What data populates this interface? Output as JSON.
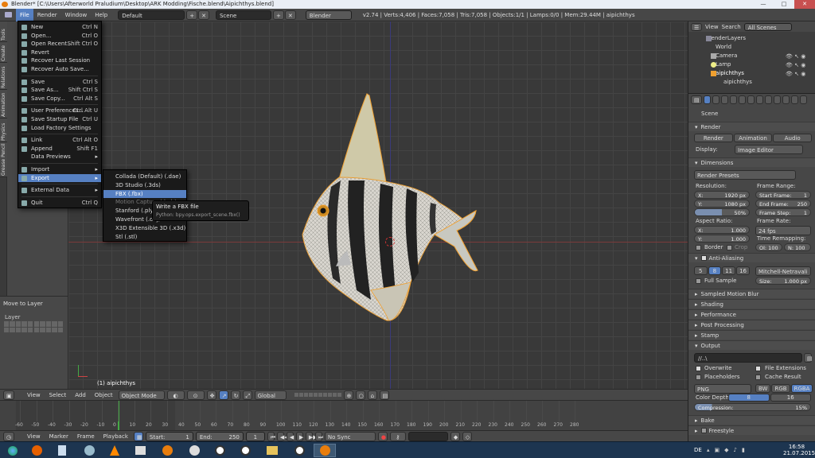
{
  "title_bar": {
    "text": "Blender* [C:\\Users\\Afterworld Praludium\\Desktop\\ARK Modding\\Fische.blend\\Aipichthys.blend]",
    "minimize": "—",
    "maximize": "□",
    "close": "✕"
  },
  "top_menu": [
    "File",
    "Render",
    "Window",
    "Help"
  ],
  "layout_field": "Default",
  "scene_field": "Scene",
  "engine_field": "Blender Render",
  "stats": "v2.74 | Verts:4,406 | Faces:7,058 | Tris:7,058 | Objects:1/1 | Lamps:0/0 | Mem:29.44M | aipichthys",
  "left_tabs": [
    "Tools",
    "Create",
    "Relations",
    "Animation",
    "Physics",
    "Grease Pencil"
  ],
  "last_op": {
    "title": "Move to Layer",
    "layer_label": "Layer"
  },
  "file_menu": {
    "items": [
      {
        "label": "New",
        "shortcut": "Ctrl N",
        "icon": "new-file-icon"
      },
      {
        "label": "Open...",
        "shortcut": "Ctrl O",
        "icon": "folder-icon"
      },
      {
        "label": "Open Recent...",
        "shortcut": "Shift Ctrl O",
        "icon": "recent-icon",
        "submenu": true
      },
      {
        "label": "Revert",
        "shortcut": "",
        "icon": "revert-icon"
      },
      {
        "label": "Recover Last Session",
        "shortcut": "",
        "icon": "recover-icon"
      },
      {
        "label": "Recover Auto Save...",
        "shortcut": "",
        "icon": "recover-auto-icon"
      },
      {
        "sep": true
      },
      {
        "label": "Save",
        "shortcut": "Ctrl S",
        "icon": "save-icon"
      },
      {
        "label": "Save As...",
        "shortcut": "Shift Ctrl S",
        "icon": "save-as-icon"
      },
      {
        "label": "Save Copy...",
        "shortcut": "Ctrl Alt S",
        "icon": "save-copy-icon"
      },
      {
        "sep": true
      },
      {
        "label": "User Preferences...",
        "shortcut": "Ctrl Alt U",
        "icon": "prefs-icon"
      },
      {
        "label": "Save Startup File",
        "shortcut": "Ctrl U",
        "icon": "startup-icon"
      },
      {
        "label": "Load Factory Settings",
        "shortcut": "",
        "icon": "factory-icon"
      },
      {
        "sep": true
      },
      {
        "label": "Link",
        "shortcut": "Ctrl Alt O",
        "icon": "link-icon"
      },
      {
        "label": "Append",
        "shortcut": "Shift F1",
        "icon": "append-icon"
      },
      {
        "label": "Data Previews",
        "shortcut": "",
        "icon": "",
        "submenu": true
      },
      {
        "sep": true
      },
      {
        "label": "Import",
        "shortcut": "",
        "icon": "import-icon",
        "submenu": true
      },
      {
        "label": "Export",
        "shortcut": "",
        "icon": "export-icon",
        "submenu": true,
        "active": true
      },
      {
        "sep": true
      },
      {
        "label": "External Data",
        "shortcut": "",
        "icon": "external-icon",
        "submenu": true
      },
      {
        "sep": true
      },
      {
        "label": "Quit",
        "shortcut": "Ctrl Q",
        "icon": "quit-icon"
      }
    ]
  },
  "export_menu": {
    "items": [
      {
        "label": "Collada (Default) (.dae)"
      },
      {
        "label": "3D Studio (.3ds)"
      },
      {
        "label": "FBX (.fbx)",
        "active": true
      },
      {
        "label": "Motion Capture (.bvh)"
      },
      {
        "label": "Stanford (.ply)"
      },
      {
        "label": "Wavefront (.obj)"
      },
      {
        "label": "X3D Extensible 3D (.x3d)"
      },
      {
        "label": "Stl (.stl)"
      }
    ]
  },
  "tooltip": {
    "title": "Write a FBX file",
    "python": "Python: bpy.ops.export_scene.fbx()"
  },
  "viewport": {
    "object_label": "(1) aipichthys"
  },
  "viewport_header": {
    "items": [
      "View",
      "Select",
      "Add",
      "Object"
    ],
    "mode": "Object Mode",
    "orientation": "Global"
  },
  "timeline": {
    "ticks": [
      "-60",
      "-50",
      "-40",
      "-30",
      "-20",
      "-10",
      "0",
      "10",
      "20",
      "30",
      "40",
      "50",
      "60",
      "70",
      "80",
      "90",
      "100",
      "110",
      "120",
      "130",
      "140",
      "150",
      "160",
      "170",
      "180",
      "190",
      "200",
      "210",
      "220",
      "230",
      "240",
      "250",
      "260",
      "270",
      "280"
    ],
    "current_frame": 0
  },
  "timeline_header": {
    "items": [
      "View",
      "Marker",
      "Frame",
      "Playback"
    ],
    "start_label": "Start:",
    "start_value": "1",
    "end_label": "End:",
    "end_value": "250",
    "current": "1",
    "sync": "No Sync"
  },
  "outliner": {
    "header": [
      "View",
      "Search"
    ],
    "scope": "All Scenes",
    "rows": [
      "RenderLayers",
      "World",
      "Camera",
      "Lamp",
      "aipichthys",
      "aipichthys"
    ]
  },
  "properties": {
    "scene_label": "Scene",
    "render_header": "Render",
    "render_buttons": [
      "Render",
      "Animation",
      "Audio"
    ],
    "display_label": "Display:",
    "display_value": "Image Editor",
    "dimensions_header": "Dimensions",
    "render_presets": "Render Presets",
    "resolution_label": "Resolution:",
    "res_x": "X:",
    "res_x_val": "1920 px",
    "res_y": "Y:",
    "res_y_val": "1080 px",
    "res_pct": "50%",
    "frame_range_label": "Frame Range:",
    "start_frame": "Start Frame:",
    "start_frame_val": "1",
    "end_frame": "End Frame:",
    "end_frame_val": "250",
    "frame_step": "Frame Step:",
    "frame_step_val": "1",
    "aspect_label": "Aspect Ratio:",
    "asp_x": "X:",
    "asp_x_val": "1.000",
    "asp_y": "Y:",
    "asp_y_val": "1.000",
    "frame_rate_label": "Frame Rate:",
    "frame_rate_val": "24 fps",
    "time_remap_label": "Time Remapping:",
    "remap_old": "Ol: 100",
    "remap_new": "N: 100",
    "border": "Border",
    "crop": "Crop",
    "aa_header": "Anti-Aliasing",
    "aa_samples": [
      "5",
      "8",
      "11",
      "16"
    ],
    "aa_filter": "Mitchell-Netravali",
    "full_sample": "Full Sample",
    "aa_size": "Size:",
    "aa_size_val": "1.000 px",
    "collapsed": [
      "Sampled Motion Blur",
      "Shading",
      "Performance",
      "Post Processing",
      "Stamp"
    ],
    "output_header": "Output",
    "output_path": "//..\\",
    "overwrite": "Overwrite",
    "file_ext": "File Extensions",
    "placeholders": "Placeholders",
    "cache_result": "Cache Result",
    "format": "PNG",
    "color_modes": [
      "BW",
      "RGB",
      "RGBA"
    ],
    "color_depth_label": "Color Depth:",
    "color_depth": [
      "8",
      "16"
    ],
    "compression": "Compression:",
    "compression_val": "15%",
    "bake": "Bake",
    "freestyle": "Freestyle"
  },
  "taskbar": {
    "lang": "DE",
    "time": "16:58",
    "date": "21.07.2015"
  },
  "colors": {
    "accent": "#5680c2",
    "selected_orange": "#f0a030",
    "taskbar": "#1d3550"
  }
}
